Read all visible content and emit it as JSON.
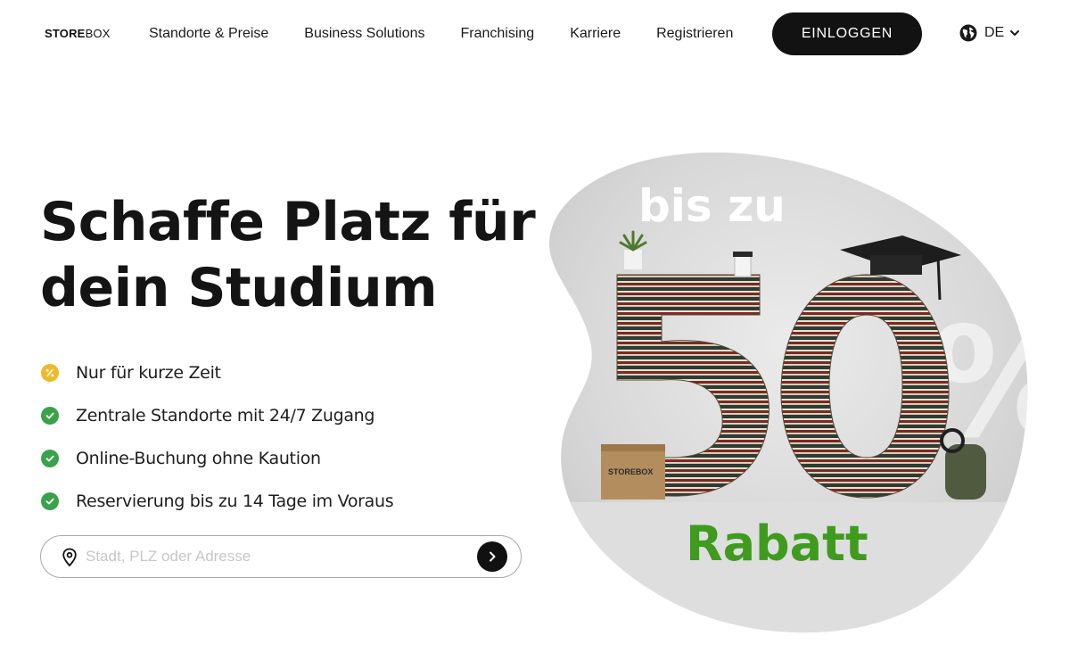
{
  "header": {
    "logo_bold": "STORE",
    "logo_light": "BOX",
    "nav": [
      "Standorte & Preise",
      "Business Solutions",
      "Franchising",
      "Karriere",
      "Registrieren"
    ],
    "login_label": "EINLOGGEN",
    "language": "DE"
  },
  "hero": {
    "title_line1": "Schaffe Platz für",
    "title_line2": "dein Studium",
    "features": [
      "Nur für kurze Zeit",
      "Zentrale Standorte mit 24/7 Zugang",
      "Online-Buchung ohne Kaution",
      "Reservierung bis zu 14 Tage im Voraus"
    ]
  },
  "search": {
    "placeholder": "Stadt, PLZ oder Adresse",
    "value": ""
  },
  "promo": {
    "top_text": "bis zu",
    "big_number": "50",
    "percent_sign": "%",
    "bottom_text": "Rabatt",
    "box_label": "STOREBOX"
  },
  "colors": {
    "primary_dark": "#121212",
    "check_green": "#3aa24a",
    "percent_yellow": "#f0b92a",
    "rabatt_green": "#3f9b1e",
    "blob_bg": "#d9d9d9"
  }
}
